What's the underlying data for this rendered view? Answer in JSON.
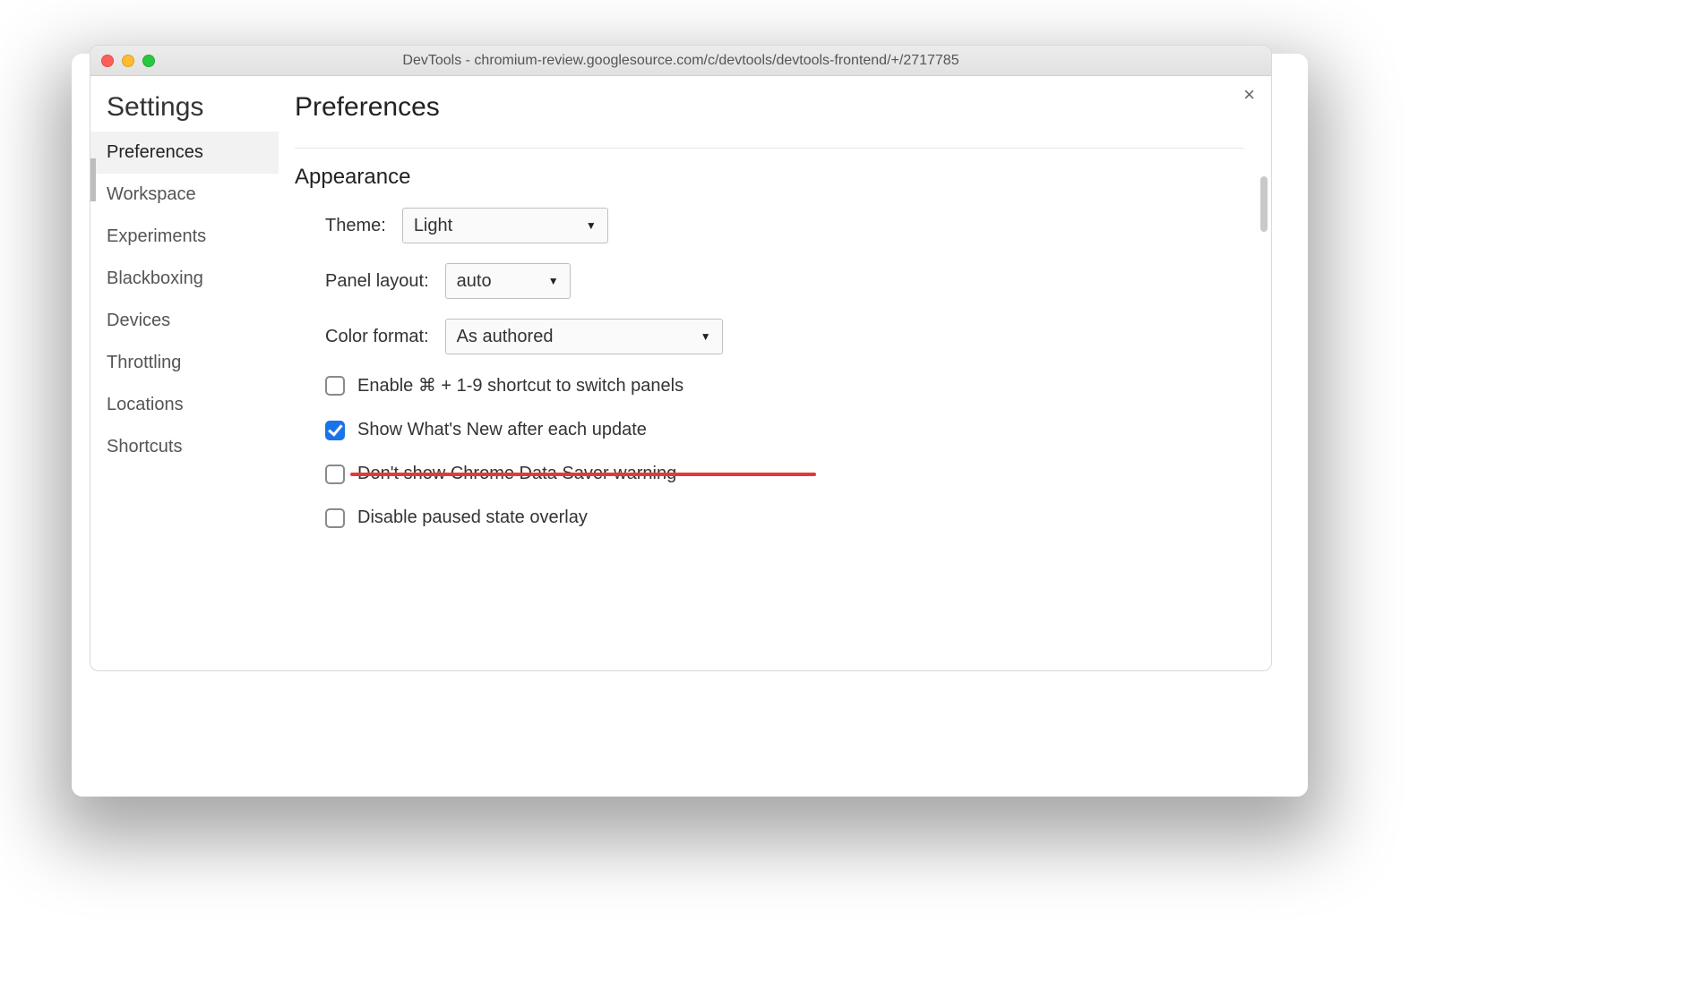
{
  "window": {
    "title": "DevTools - chromium-review.googlesource.com/c/devtools/devtools-frontend/+/2717785"
  },
  "sidebar": {
    "header": "Settings",
    "items": [
      {
        "label": "Preferences",
        "active": true
      },
      {
        "label": "Workspace"
      },
      {
        "label": "Experiments"
      },
      {
        "label": "Blackboxing"
      },
      {
        "label": "Devices"
      },
      {
        "label": "Throttling"
      },
      {
        "label": "Locations"
      },
      {
        "label": "Shortcuts"
      }
    ]
  },
  "main": {
    "title": "Preferences",
    "close_label": "×",
    "appearance": {
      "heading": "Appearance",
      "theme": {
        "label": "Theme:",
        "value": "Light"
      },
      "panel_layout": {
        "label": "Panel layout:",
        "value": "auto"
      },
      "color_format": {
        "label": "Color format:",
        "value": "As authored"
      },
      "checkboxes": [
        {
          "label": "Enable ⌘ + 1-9 shortcut to switch panels",
          "checked": false,
          "strikethrough": false
        },
        {
          "label": "Show What's New after each update",
          "checked": true,
          "strikethrough": false
        },
        {
          "label": "Don't show Chrome Data Saver warning",
          "checked": false,
          "strikethrough": true
        },
        {
          "label": "Disable paused state overlay",
          "checked": false,
          "strikethrough": false
        }
      ]
    }
  }
}
